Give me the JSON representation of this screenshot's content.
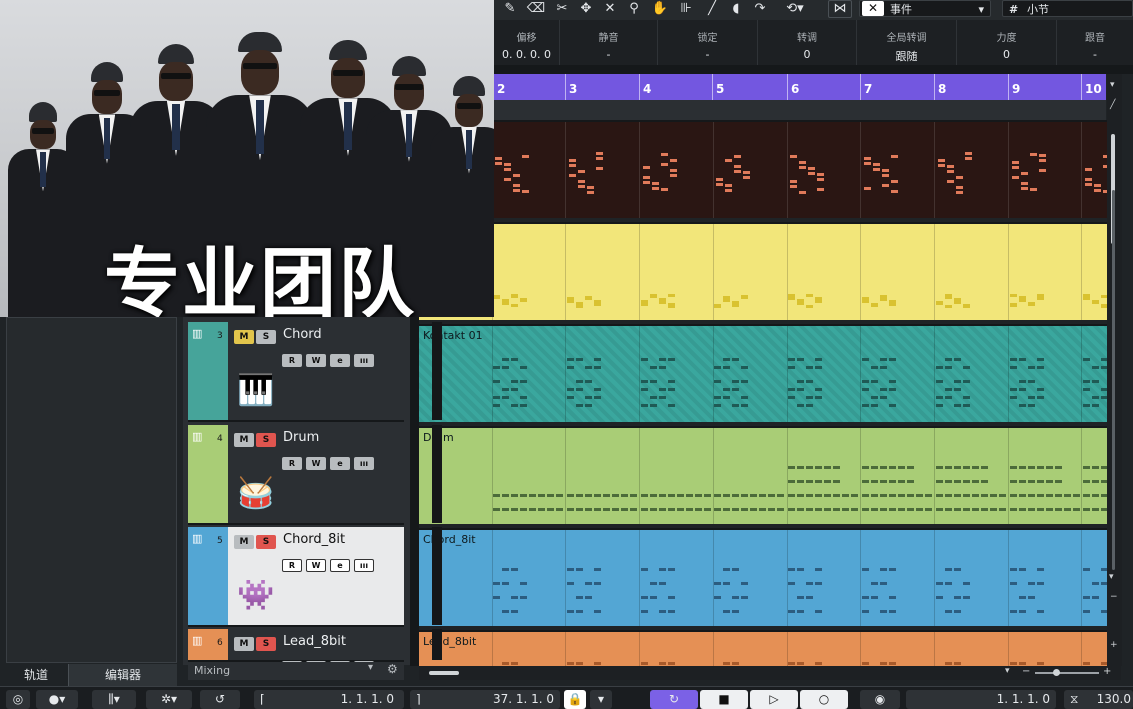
{
  "toolbar": {
    "event_select": "事件",
    "grid_select": "小节"
  },
  "infoline": [
    {
      "label": "偏移",
      "value": "0. 0. 0.   0"
    },
    {
      "label": "静音",
      "value": "-"
    },
    {
      "label": "锁定",
      "value": "-"
    },
    {
      "label": "转调",
      "value": "0"
    },
    {
      "label": "全局转调",
      "value": "跟随"
    },
    {
      "label": "力度",
      "value": "0"
    },
    {
      "label": "跟音",
      "value": "-"
    }
  ],
  "ruler": {
    "bars": [
      "2",
      "3",
      "4",
      "5",
      "6",
      "7",
      "8",
      "9",
      "10"
    ]
  },
  "lanes": [
    {
      "name": "",
      "color": "#2a1613"
    },
    {
      "name": "",
      "color": "#f2e67a"
    },
    {
      "name": "Kontakt 01",
      "color": "#3aa79e"
    },
    {
      "name": "Drum",
      "color": "#a9cd76"
    },
    {
      "name": "Chord_8it",
      "color": "#53a6d4"
    },
    {
      "name": "Lead_8bit",
      "color": "#e59055"
    }
  ],
  "tracks": [
    {
      "number": "3",
      "name": "Chord",
      "color": "#46a49a",
      "mute": "M",
      "solo": "S",
      "mute_on": true,
      "solo_on": false,
      "selected": false,
      "instrument_icon": "piano-icon"
    },
    {
      "number": "4",
      "name": "Drum",
      "color": "#a9cd76",
      "mute": "M",
      "solo": "S",
      "mute_on": false,
      "solo_on": true,
      "selected": false,
      "instrument_icon": "drum-icon"
    },
    {
      "number": "5",
      "name": "Chord_8it",
      "color": "#53a6d4",
      "mute": "M",
      "solo": "S",
      "mute_on": false,
      "solo_on": true,
      "selected": true,
      "instrument_icon": "space-invader-icon"
    },
    {
      "number": "6",
      "name": "Lead_8bit",
      "color": "#e59055",
      "mute": "M",
      "solo": "S",
      "mute_on": false,
      "solo_on": true,
      "selected": false,
      "instrument_icon": "lead-icon"
    }
  ],
  "track_buttons": {
    "read": "R",
    "write": "W",
    "edit": "e",
    "insert": "ııı"
  },
  "mixing_label": "Mixing",
  "left_tabs": {
    "tracks": "轨道",
    "editor": "编辑器"
  },
  "meme_caption": "专业团队",
  "transport": {
    "left_locator": "1. 1. 1.   0",
    "right_locator": "37. 1. 1.   0",
    "position": "1. 1. 1.   0",
    "tempo": "130.0"
  }
}
